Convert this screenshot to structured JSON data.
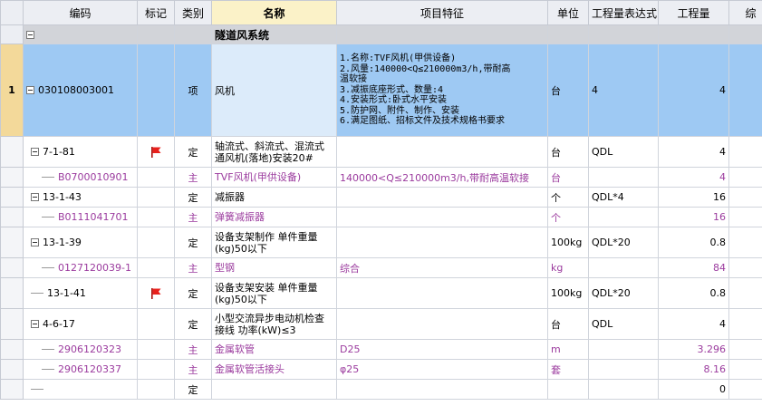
{
  "columns": [
    "编码",
    "标记",
    "类别",
    "名称",
    "项目特征",
    "单位",
    "工程量表达式",
    "工程量",
    "综"
  ],
  "section": {
    "label": "隧道风系统"
  },
  "main": {
    "rownum": "1",
    "code": "030108003001",
    "category": "项",
    "name": "风机",
    "features": [
      "1.名称:TVF风机(甲供设备)",
      "2.风量:140000<Q≤210000m3/h,带耐高",
      "温软接",
      "3.减振底座形式、数量:4",
      "4.安装形式:卧式水平安装",
      "5.防护网、附件、制作、安装",
      "6.满足图纸、招标文件及技术规格书要求"
    ],
    "unit": "台",
    "expr": "4",
    "qty": "4"
  },
  "rows": [
    {
      "code": "7-1-81",
      "flag": true,
      "category": "定",
      "name": "轴流式、斜流式、混流式通风机(落地)安装20#",
      "features": "",
      "unit": "台",
      "expr": "QDL",
      "qty": "4",
      "toggle": true,
      "style": "norm"
    },
    {
      "code": "B0700010901",
      "flag": false,
      "category": "主",
      "name": "TVF风机(甲供设备)",
      "features": "140000<Q≤210000m3/h,带耐高温软接",
      "unit": "台",
      "expr": "",
      "qty": "4",
      "toggle": false,
      "style": "pur"
    },
    {
      "code": "13-1-43",
      "flag": false,
      "category": "定",
      "name": "减振器",
      "features": "",
      "unit": "个",
      "expr": "QDL*4",
      "qty": "16",
      "toggle": true,
      "style": "norm"
    },
    {
      "code": "B0111041701",
      "flag": false,
      "category": "主",
      "name": "弹簧减振器",
      "features": "",
      "unit": "个",
      "expr": "",
      "qty": "16",
      "toggle": false,
      "style": "pur"
    },
    {
      "code": "13-1-39",
      "flag": false,
      "category": "定",
      "name": "设备支架制作 单件重量(kg)50以下",
      "features": "",
      "unit": "100kg",
      "expr": "QDL*20",
      "qty": "0.8",
      "toggle": true,
      "style": "norm"
    },
    {
      "code": "0127120039-1",
      "flag": false,
      "category": "主",
      "name": "型钢",
      "features": "综合",
      "unit": "kg",
      "expr": "",
      "qty": "84",
      "toggle": false,
      "style": "pur"
    },
    {
      "code": "13-1-41",
      "flag": true,
      "category": "定",
      "name": "设备支架安装 单件重量(kg)50以下",
      "features": "",
      "unit": "100kg",
      "expr": "QDL*20",
      "qty": "0.8",
      "toggle": false,
      "style": "norm"
    },
    {
      "code": "4-6-17",
      "flag": false,
      "category": "定",
      "name": "小型交流异步电动机检查接线 功率(kW)≤3",
      "features": "",
      "unit": "台",
      "expr": "QDL",
      "qty": "4",
      "toggle": true,
      "style": "norm"
    },
    {
      "code": "2906120323",
      "flag": false,
      "category": "主",
      "name": "金属软管",
      "features": "D25",
      "unit": "m",
      "expr": "",
      "qty": "3.296",
      "toggle": false,
      "style": "pur"
    },
    {
      "code": "2906120337",
      "flag": false,
      "category": "主",
      "name": "金属软管活接头",
      "features": "φ25",
      "unit": "套",
      "expr": "",
      "qty": "8.16",
      "toggle": false,
      "style": "pur"
    },
    {
      "code": "",
      "flag": false,
      "category": "定",
      "name": "",
      "features": "",
      "unit": "",
      "expr": "",
      "qty": "0",
      "toggle": false,
      "style": "norm"
    }
  ],
  "colors": {
    "header": "#eceef3",
    "selected": "#9ec9f3",
    "section": "#d2d4d9",
    "material_text": "#9b3b9e",
    "flag": "#e8201c"
  },
  "icons": {
    "flag": "red-flag-icon",
    "collapse": "collapse-toggle-icon"
  }
}
